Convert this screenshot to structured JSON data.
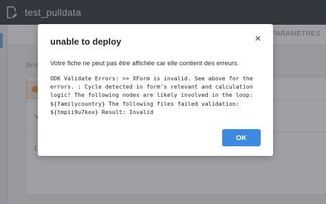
{
  "app": {
    "project_title": "test_pulldata",
    "project_icon": "form-edit-icon"
  },
  "background": {
    "tab_params": "PARAMÈTRES",
    "breadcrumb_partial": "Brou",
    "row_letter_1": "V",
    "row_letter_2": "L"
  },
  "modal": {
    "title": "unable to deploy",
    "close_icon": "×",
    "message": "Votre fiche ne peut pas être affichée car elle contient des erreurs.",
    "error_lines": [
      "ODK Validate Errors: >> XForm is invalid. See above for the",
      "errors. : Cycle detected in form's relevant and calculation",
      "logic! The following nodes are likely involved in the loop:",
      "${familycountry} The following files failed validation:",
      "${tmpii9u7kox} Result: Invalid"
    ],
    "ok_label": "OK"
  },
  "colors": {
    "topbar": "#3d4248",
    "ok_button": "#3d8be0",
    "overlay": "rgba(40,44,50,0.45)"
  }
}
